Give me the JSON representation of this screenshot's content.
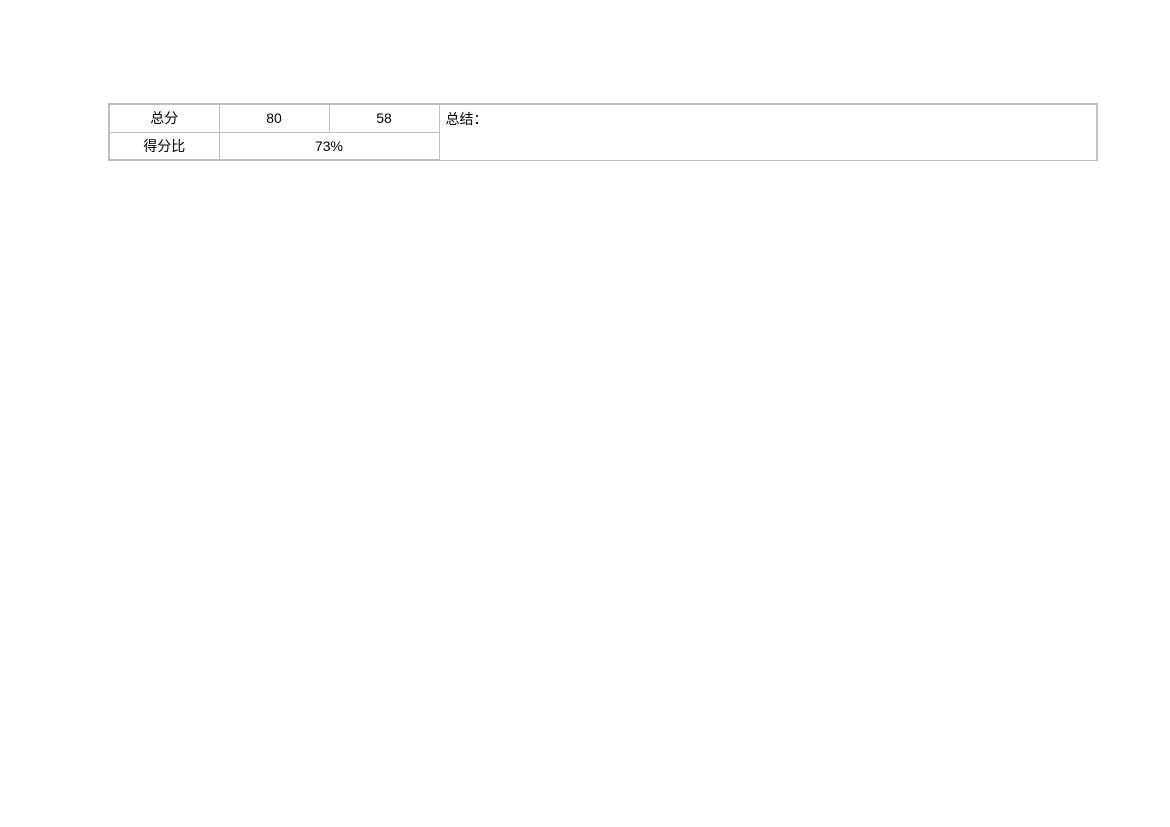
{
  "table": {
    "row1": {
      "label": "总分",
      "value1": "80",
      "value2": "58"
    },
    "row2": {
      "label": "得分比",
      "percent": "73%"
    },
    "summary_label": "总结："
  }
}
